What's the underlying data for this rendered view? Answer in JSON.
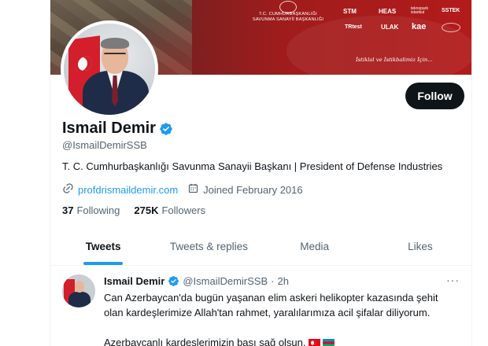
{
  "banner": {
    "institution_line1": "T.C. CUMHURBAŞKANLIĞI",
    "institution_line2": "SAVUNMA SANAYİİ BAŞKANLIĞI",
    "logos": [
      "STM",
      "HEAS",
      "teknopark istanbul",
      "SSTEK",
      "TRtest",
      "ULAK",
      "kae"
    ],
    "slogan": "İstiklal ve İstikbalimiz İçin..."
  },
  "profile": {
    "follow_label": "Follow",
    "display_name": "Ismail Demir",
    "handle": "@IsmailDemirSSB",
    "bio": "T. C. Cumhurbaşkanlığı Savunma Sanayii Başkanı | President of Defense Industries",
    "website": "profdrismaildemir.com",
    "joined": "Joined February 2016",
    "following_count": "37",
    "following_label": "Following",
    "followers_count": "275K",
    "followers_label": "Followers",
    "verified": true
  },
  "tabs": [
    {
      "label": "Tweets",
      "active": true
    },
    {
      "label": "Tweets & replies",
      "active": false
    },
    {
      "label": "Media",
      "active": false
    },
    {
      "label": "Likes",
      "active": false
    }
  ],
  "tweet": {
    "name": "Ismail Demir",
    "handle": "@IsmailDemirSSB",
    "separator": "·",
    "time": "2h",
    "more": "···",
    "line1": "Can Azerbaycan'da bugün yaşanan elim askeri helikopter kazasında şehit",
    "line2": "olan kardeşlerimize Allah'tan rahmet, yaralılarımıza acil şifalar diliyorum.",
    "line3": "Azerbaycanlı kardeşlerimizin başı sağ olsun."
  },
  "colors": {
    "accent": "#1d9bf0",
    "text": "#0f1419",
    "secondary": "#536471",
    "banner_red": "#a01c1c",
    "button_bg": "#0f1419"
  },
  "icons": [
    "verified-icon",
    "link-icon",
    "calendar-icon",
    "more-icon",
    "turkey-flag-emoji",
    "azerbaijan-flag-emoji"
  ]
}
